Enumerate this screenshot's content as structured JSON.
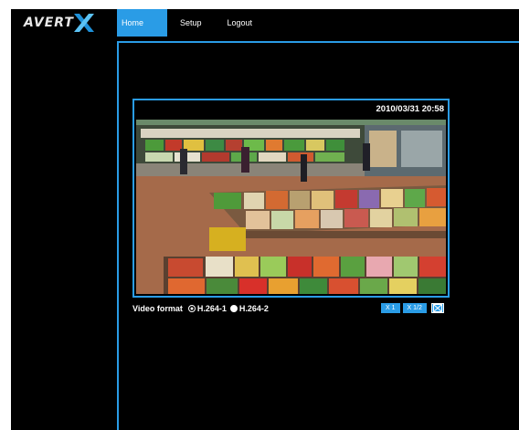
{
  "brand": {
    "logo_text": "AVERT",
    "accent": "#2a9ce6"
  },
  "nav": {
    "tabs": [
      {
        "label": "Home"
      },
      {
        "label": "Setup"
      },
      {
        "label": "Logout"
      }
    ]
  },
  "viewer": {
    "timestamp": "2010/03/31 20:58",
    "feed_icon": "camera-feed-grocery-store"
  },
  "video_format": {
    "label": "Video format",
    "options": [
      {
        "label": "H.264-1",
        "selected": true
      },
      {
        "label": "H.264-2",
        "selected": false
      }
    ]
  },
  "zoom": {
    "x1": "X 1",
    "xhalf": "X 1/2",
    "fullscreen_icon": "fullscreen-icon"
  }
}
